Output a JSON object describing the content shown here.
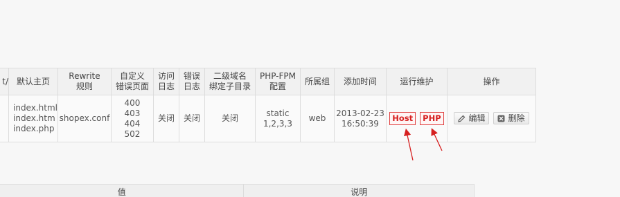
{
  "table": {
    "headers": {
      "prev_fragment": "t/",
      "default_page": "默认主页",
      "rewrite_line1": "Rewrite",
      "rewrite_line2": "规则",
      "custom_error_line1": "自定义",
      "custom_error_line2": "错误页面",
      "access_log_line1": "访问",
      "access_log_line2": "日志",
      "error_log_line1": "错误",
      "error_log_line2": "日志",
      "subdomain_line1": "二级域名",
      "subdomain_line2": "绑定子目录",
      "php_fpm_line1": "PHP-FPM",
      "php_fpm_line2": "配置",
      "group": "所属组",
      "added_time": "添加时间",
      "maintenance": "运行维护",
      "actions": "操作"
    },
    "row": {
      "default_pages": [
        "index.html",
        "index.htm",
        "index.php"
      ],
      "rewrite": "shopex.conf",
      "error_pages": [
        "400",
        "403",
        "404",
        "502"
      ],
      "access_log": "关闭",
      "error_log": "关闭",
      "subdomain": "关闭",
      "php_fpm_line1": "static",
      "php_fpm_line2": "1,2,3,3",
      "group": "web",
      "added_date": "2013-02-23",
      "added_time": "16:50:39",
      "host_tag": "Host",
      "php_tag": "PHP",
      "edit_label": "编辑",
      "delete_label": "删除"
    }
  },
  "lower_table": {
    "value_header": "值",
    "description_header": "说明"
  },
  "icons": {
    "edit": "pencil-icon",
    "delete": "close-circle-icon"
  },
  "colors": {
    "tag_red": "#d62020",
    "arrow_red": "#d62020"
  }
}
